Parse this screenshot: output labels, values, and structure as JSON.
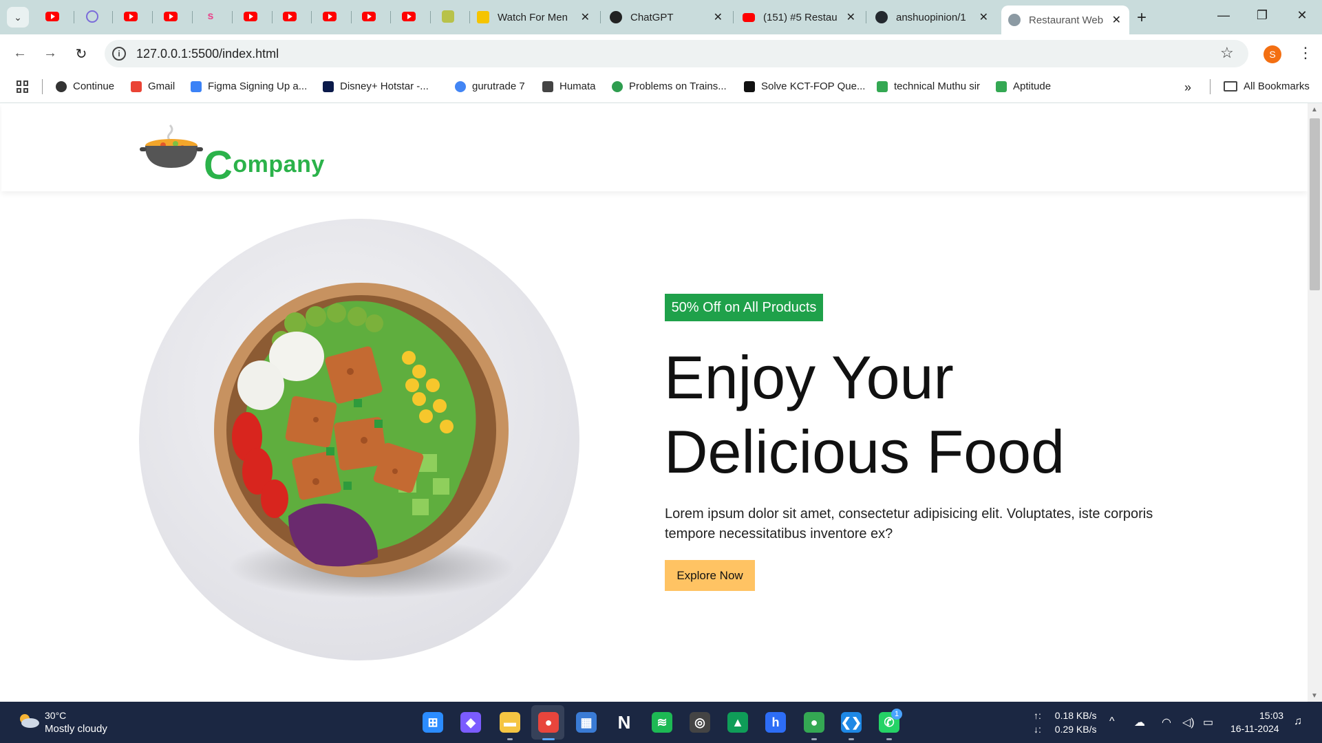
{
  "tabs": {
    "items": [
      {
        "title": "Watch For Men",
        "color": "#f5c400"
      },
      {
        "title": "ChatGPT",
        "color": "#222222"
      },
      {
        "title": "(151) #5 Restau",
        "color": "#ff0000"
      },
      {
        "title": "anshuopinion/1",
        "color": "#24292f"
      },
      {
        "title": "Restaurant Web",
        "color": "#8c9aa3"
      }
    ],
    "pinned_icons": [
      "youtube-icon",
      "tor-icon",
      "youtube-icon",
      "youtube-icon",
      "s-icon",
      "youtube-icon",
      "youtube-icon",
      "youtube-icon",
      "youtube-icon",
      "youtube-icon",
      "mascot-icon"
    ],
    "s_glyph": "s",
    "close_glyph": "✕",
    "new_tab_glyph": "+",
    "menu_glyph": "⌄"
  },
  "window": {
    "minimize": "—",
    "restore": "❐",
    "close": "✕"
  },
  "toolbar": {
    "back": "←",
    "forward": "→",
    "reload": "↻",
    "info": "i",
    "url": "127.0.0.1:5500/index.html",
    "star": "☆",
    "profile_initial": "S",
    "menu": "⋮"
  },
  "bookmarks": {
    "items": [
      {
        "label": "Continue",
        "color": "#333333"
      },
      {
        "label": "Gmail",
        "color": "#ea4335"
      },
      {
        "label": "Figma Signing Up a...",
        "color": "#3b82f6"
      },
      {
        "label": "Disney+ Hotstar -...",
        "color": "#0b1a4a"
      },
      {
        "label": "gurutrade 7",
        "color": "#4285f4"
      },
      {
        "label": "Humata",
        "color": "#444444"
      },
      {
        "label": "Problems on Trains...",
        "color": "#2e9d4f"
      },
      {
        "label": "Solve KCT-FOP Que...",
        "color": "#111111"
      },
      {
        "label": "technical Muthu sir",
        "color": "#34a853"
      },
      {
        "label": "Aptitude",
        "color": "#34a853"
      }
    ],
    "overflow": "»",
    "all_bookmarks": "All Bookmarks"
  },
  "site": {
    "logo_initial": "C",
    "logo_rest": "ompany",
    "offer": "50% Off on All Products",
    "title_line1": "Enjoy Your",
    "title_line2": "Delicious Food",
    "description": "Lorem ipsum dolor sit amet, consectetur adipisicing elit. Voluptates, iste corporis tempore necessitatibus inventore ex?",
    "cta": "Explore Now"
  },
  "taskbar": {
    "temperature": "30°C",
    "weather": "Mostly cloudy",
    "apps": [
      {
        "name": "windows-start-icon",
        "glyph": "⊞",
        "color": "#2b8cff"
      },
      {
        "name": "copilot-icon",
        "glyph": "◆",
        "color": "#7b5cff"
      },
      {
        "name": "file-explorer-icon",
        "glyph": "▬",
        "color": "#f5c542"
      },
      {
        "name": "chrome-icon",
        "glyph": "●",
        "color": "#e8453c"
      },
      {
        "name": "store-icon",
        "glyph": "▦",
        "color": "#3a7bd5"
      },
      {
        "name": "notion-icon",
        "glyph": "N",
        "color": "#1b2742"
      },
      {
        "name": "spotify-icon",
        "glyph": "≋",
        "color": "#1db954"
      },
      {
        "name": "obs-icon",
        "glyph": "◎",
        "color": "#444444"
      },
      {
        "name": "google-drive-icon",
        "glyph": "▲",
        "color": "#0f9d58"
      },
      {
        "name": "h-app-icon",
        "glyph": "h",
        "color": "#2d6df6"
      },
      {
        "name": "chrome-profile-icon",
        "glyph": "●",
        "color": "#34a853"
      },
      {
        "name": "vscode-icon",
        "glyph": "❮❯",
        "color": "#1e88e5"
      },
      {
        "name": "whatsapp-icon",
        "glyph": "✆",
        "color": "#25d366"
      }
    ],
    "whatsapp_badge": "1",
    "upload_label": "↑:",
    "download_label": "↓:",
    "upload_speed": "0.18 KB/s",
    "download_speed": "0.29 KB/s",
    "time": "15:03",
    "date": "16-11-2024"
  },
  "colors": {
    "brand_green": "#2bb24a",
    "offer_bg": "#1fa14a",
    "cta_bg": "#ffc363",
    "tabstrip_bg": "#c9dcdc",
    "taskbar_bg": "#1b2742"
  }
}
